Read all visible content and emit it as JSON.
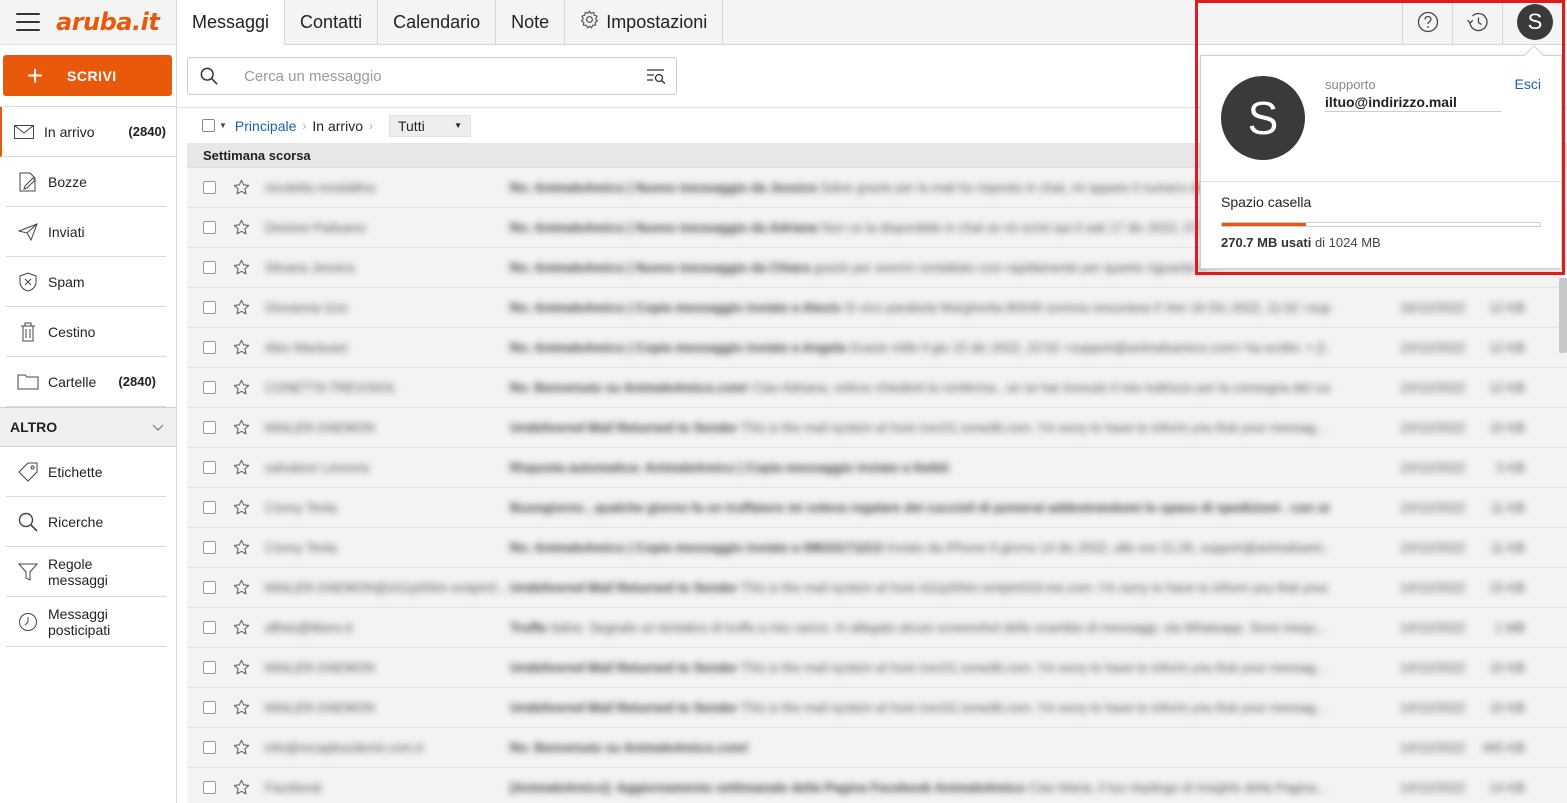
{
  "brand": {
    "logo": "aruba.it"
  },
  "compose": {
    "label": "SCRIVI"
  },
  "tabs": [
    {
      "label": "Messaggi",
      "active": true
    },
    {
      "label": "Contatti",
      "active": false
    },
    {
      "label": "Calendario",
      "active": false
    },
    {
      "label": "Note",
      "active": false
    },
    {
      "label": "Impostazioni",
      "active": false,
      "icon": "gear-icon"
    }
  ],
  "folders": [
    {
      "label": "In arrivo",
      "count": "(2840)",
      "icon": "envelope-icon",
      "active": true
    },
    {
      "label": "Bozze",
      "count": "",
      "icon": "draft-icon"
    },
    {
      "label": "Inviati",
      "count": "",
      "icon": "send-icon"
    },
    {
      "label": "Spam",
      "count": "",
      "icon": "spam-icon"
    },
    {
      "label": "Cestino",
      "count": "",
      "icon": "trash-icon"
    },
    {
      "label": "Cartelle",
      "count": "(2840)",
      "icon": "folder-icon"
    }
  ],
  "altro": {
    "label": "ALTRO",
    "items": [
      {
        "label": "Etichette",
        "icon": "tag-icon"
      },
      {
        "label": "Ricerche",
        "icon": "search-icon"
      },
      {
        "label": "Regole messaggi",
        "icon": "filter-icon"
      },
      {
        "label": "Messaggi posticipati",
        "icon": "clock-icon"
      }
    ]
  },
  "search": {
    "placeholder": "Cerca un messaggio"
  },
  "breadcrumb": {
    "root": "Principale",
    "current": "In arrivo",
    "filter": "Tutti"
  },
  "list": {
    "group_label": "Settimana scorsa",
    "rows": [
      {
        "sender": "nicoletta mostallino",
        "subject": "Re: AnimaleAmico | Nuovo messaggio da Jessica",
        "preview": "Salve grazie per la mail ho risposto in chat, mi appare il numero del...",
        "date": "",
        "size": ""
      },
      {
        "sender": "Desiree Paduano",
        "subject": "Re: AnimaleAmico | Nuovo messaggio da Adriana",
        "preview": "Non ce la disponibile in chat se mi scrivi qui il sab 17 dic 2022, 07:3...",
        "date": "",
        "size": ""
      },
      {
        "sender": "Silvana Jessica",
        "subject": "Re: AnimaleAmico | Nuovo messaggio da Chiara",
        "preview": "grazie per avermi contattato così rapidamente per quanto riguarda il ...",
        "date": "",
        "size": ""
      },
      {
        "sender": "Giovanna Izzo",
        "subject": "Re: AnimaleAmico | Copia messaggio inviato a Alexis",
        "preview": "Si vico parabola Margherita 80049 somma vesuviana Il Ven 16 Dic 2022, 11:02 <supp...",
        "date": "16/12/2022",
        "size": "12 KB"
      },
      {
        "sender": "Alex Mantuani",
        "subject": "Re: AnimaleAmico | Copia messaggio inviato a Angela",
        "preview": "Grazie mille Il gio 15 dic 2022, 22:02 <support@animalsamico.com> ha scritto: > [I...",
        "date": "15/12/2022",
        "size": "12 KB"
      },
      {
        "sender": "CONETTA TREVISIOL",
        "subject": "Re: Benvenuto su AnimaleAmico.com!",
        "preview": "Ciao Adriana, volevo chiederti la conferma , se se hai ricevuto il mio indirizzo per la consegna del cuc...",
        "date": "15/12/2022",
        "size": "12 KB"
      },
      {
        "sender": "MAILER-DAEMON",
        "subject": "Undelivered Mail Returned to Sender",
        "preview": "This is the mail system at host mxc01.zonedit.com. I'm sorry to have to inform you that your messag...",
        "date": "15/12/2022",
        "size": "10 KB"
      },
      {
        "sender": "salvatore Leonora",
        "subject": "Risposta automatica: AnimaleAmico | Copia messaggio inviato a Ilotbit",
        "preview": "",
        "date": "15/12/2022",
        "size": "5 KB"
      },
      {
        "sender": "Conny Testa",
        "subject": "Buongiorno , qualche giorno fa un truffatore mi voleva regalare dei cuccioli di pomerai addestrandomi lo spaso di spedizioni . con una ricari...",
        "preview": "",
        "date": "15/12/2022",
        "size": "11 KB"
      },
      {
        "sender": "Conny Testa",
        "subject": "Re: AnimaleAmico | Copia messaggio inviato a 08633171213",
        "preview": "Inviato da iPhone Il giorno 14 dic 2022, alle ore 21:26, support@animalsami...",
        "date": "15/12/2022",
        "size": "11 KB"
      },
      {
        "sender": "MAILER-DAEMON@st11p00im-smtpin0...",
        "subject": "Undelivered Mail Returned to Sender",
        "preview": "This is the mail system at host st11p00im-smtpin019.me.com. I'm sorry to have to inform you that your...",
        "date": "14/12/2022",
        "size": "15 KB"
      },
      {
        "sender": "affoto@libero.it",
        "subject": "Truffa",
        "preview": "Salve. Segnalo un tentativo di truffa a mio carico. In allegato alcuni screenshot dello scambio di messaggi, via Whatsapp. Sono inequ...",
        "date": "14/12/2022",
        "size": "1 MB"
      },
      {
        "sender": "MAILER-DAEMON",
        "subject": "Undelivered Mail Returned to Sender",
        "preview": "This is the mail system at host mxc01.zonedit.com. I'm sorry to have to inform you that your messag...",
        "date": "14/12/2022",
        "size": "10 KB"
      },
      {
        "sender": "MAILER-DAEMON",
        "subject": "Undelivered Mail Returned to Sender",
        "preview": "This is the mail system at host mxc02.zonedit.com. I'm sorry to have to inform you that your messag...",
        "date": "14/12/2022",
        "size": "10 KB"
      },
      {
        "sender": "info@recapbozdemir.com.tr",
        "subject": "Re: Benvenuto su AnimaleAmico.com!",
        "preview": "",
        "date": "14/12/2022",
        "size": "465 KB"
      },
      {
        "sender": "Facebook",
        "subject": "[AnimaleAmico]: Aggiornamento settimanale della Pagina Facebook AnimaleAmico",
        "preview": "Ciao Maria, il tuo riepilogo di Insights della Pagina...",
        "date": "14/12/2022",
        "size": "14 KB"
      }
    ]
  },
  "account": {
    "initial": "S",
    "name": "supporto",
    "email": "iltuo@indirizzo.mail",
    "logout": "Esci",
    "quota_title": "Spazio casella",
    "quota_used": "270.7 MB usati",
    "quota_total": "di 1024 MB",
    "quota_fraction": 0.264
  },
  "colors": {
    "accent": "#e8590c",
    "highlight": "#e01b1b",
    "link": "#1a63a8"
  }
}
